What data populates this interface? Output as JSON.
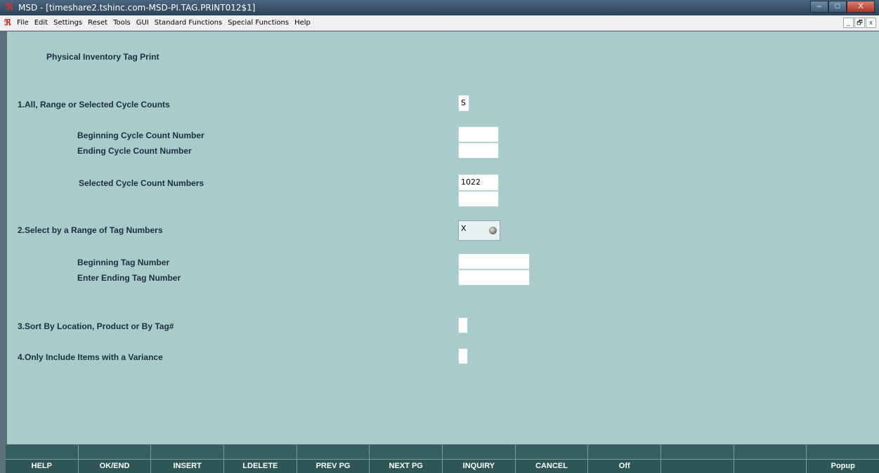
{
  "window": {
    "title": "MSD - [timeshare2.tshinc.com-MSD-PI.TAG.PRINT012$1]",
    "controls": {
      "minimize": "–",
      "maximize": "□",
      "close": "X"
    }
  },
  "menubar": {
    "items": [
      "File",
      "Edit",
      "Settings",
      "Reset",
      "Tools",
      "GUI",
      "Standard Functions",
      "Special Functions",
      "Help"
    ],
    "mdi": {
      "minimize": "_",
      "restore": "🗗",
      "close": "x"
    }
  },
  "form": {
    "title": "Physical Inventory Tag Print",
    "q1": {
      "label": "1.All, Range or Selected Cycle Counts",
      "value": "S",
      "begin_label": "Beginning Cycle Count Number",
      "begin_value": "",
      "end_label": "Ending Cycle Count Number",
      "end_value": "",
      "selected_label": "Selected Cycle Count Numbers",
      "selected_values": [
        "1022",
        ""
      ]
    },
    "q2": {
      "label": "2.Select by a Range of Tag Numbers",
      "value": "X",
      "begin_label": "Beginning Tag Number",
      "begin_value": "",
      "end_label": "Enter Ending Tag Number",
      "end_value": ""
    },
    "q3": {
      "label": "3.Sort By Location, Product or By Tag#",
      "value": ""
    },
    "q4": {
      "label": "4.Only Include Items with a Variance",
      "value": ""
    }
  },
  "function_keys": [
    "HELP",
    "OK/END",
    "INSERT",
    "LDELETE",
    "PREV PG",
    "NEXT PG",
    "INQUIRY",
    "CANCEL",
    "Off",
    "",
    "",
    "Popup"
  ]
}
